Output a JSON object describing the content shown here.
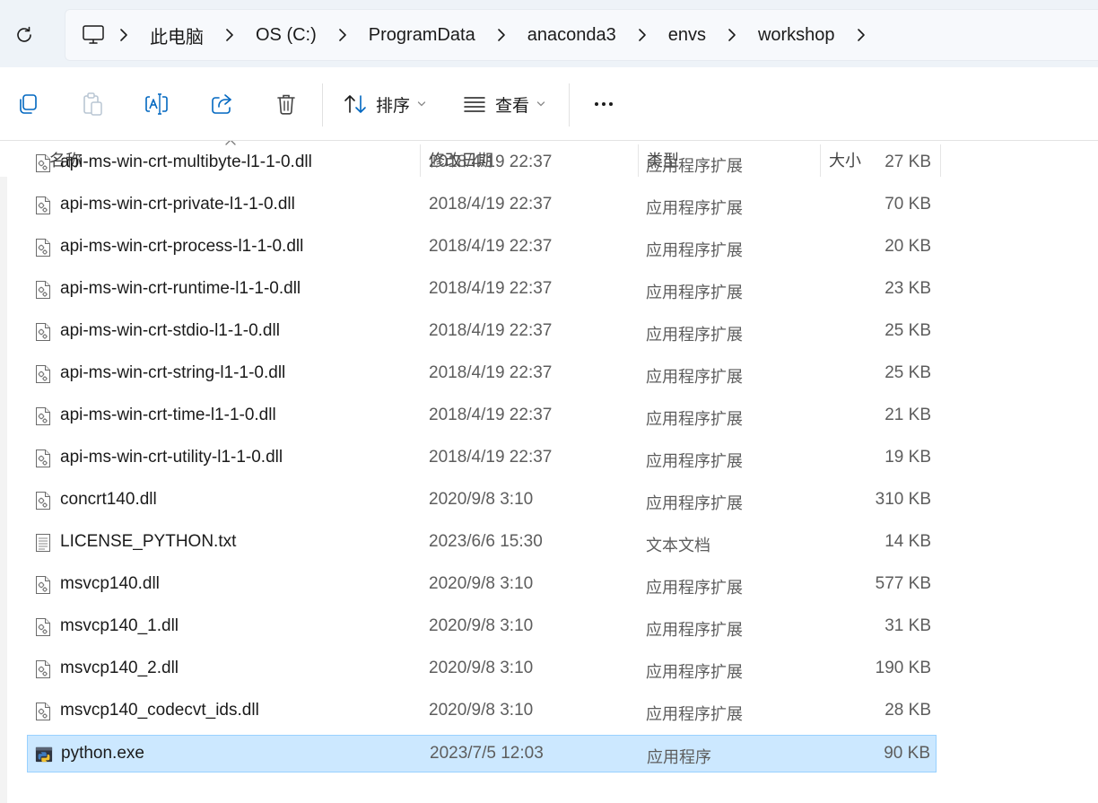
{
  "address_bar": {
    "breadcrumbs": [
      "此电脑",
      "OS (C:)",
      "ProgramData",
      "anaconda3",
      "envs",
      "workshop"
    ]
  },
  "toolbar": {
    "sort_label": "排序",
    "view_label": "查看"
  },
  "columns": {
    "name": "名称",
    "modified": "修改日期",
    "type": "类型",
    "size": "大小"
  },
  "files": [
    {
      "name": "api-ms-win-crt-multibyte-l1-1-0.dll",
      "modified": "2018/4/19 22:37",
      "type": "应用程序扩展",
      "size": "27 KB",
      "icon": "dll-file-icon"
    },
    {
      "name": "api-ms-win-crt-private-l1-1-0.dll",
      "modified": "2018/4/19 22:37",
      "type": "应用程序扩展",
      "size": "70 KB",
      "icon": "dll-file-icon"
    },
    {
      "name": "api-ms-win-crt-process-l1-1-0.dll",
      "modified": "2018/4/19 22:37",
      "type": "应用程序扩展",
      "size": "20 KB",
      "icon": "dll-file-icon"
    },
    {
      "name": "api-ms-win-crt-runtime-l1-1-0.dll",
      "modified": "2018/4/19 22:37",
      "type": "应用程序扩展",
      "size": "23 KB",
      "icon": "dll-file-icon"
    },
    {
      "name": "api-ms-win-crt-stdio-l1-1-0.dll",
      "modified": "2018/4/19 22:37",
      "type": "应用程序扩展",
      "size": "25 KB",
      "icon": "dll-file-icon"
    },
    {
      "name": "api-ms-win-crt-string-l1-1-0.dll",
      "modified": "2018/4/19 22:37",
      "type": "应用程序扩展",
      "size": "25 KB",
      "icon": "dll-file-icon"
    },
    {
      "name": "api-ms-win-crt-time-l1-1-0.dll",
      "modified": "2018/4/19 22:37",
      "type": "应用程序扩展",
      "size": "21 KB",
      "icon": "dll-file-icon"
    },
    {
      "name": "api-ms-win-crt-utility-l1-1-0.dll",
      "modified": "2018/4/19 22:37",
      "type": "应用程序扩展",
      "size": "19 KB",
      "icon": "dll-file-icon"
    },
    {
      "name": "concrt140.dll",
      "modified": "2020/9/8 3:10",
      "type": "应用程序扩展",
      "size": "310 KB",
      "icon": "dll-file-icon"
    },
    {
      "name": "LICENSE_PYTHON.txt",
      "modified": "2023/6/6 15:30",
      "type": "文本文档",
      "size": "14 KB",
      "icon": "text-file-icon"
    },
    {
      "name": "msvcp140.dll",
      "modified": "2020/9/8 3:10",
      "type": "应用程序扩展",
      "size": "577 KB",
      "icon": "dll-file-icon"
    },
    {
      "name": "msvcp140_1.dll",
      "modified": "2020/9/8 3:10",
      "type": "应用程序扩展",
      "size": "31 KB",
      "icon": "dll-file-icon"
    },
    {
      "name": "msvcp140_2.dll",
      "modified": "2020/9/8 3:10",
      "type": "应用程序扩展",
      "size": "190 KB",
      "icon": "dll-file-icon"
    },
    {
      "name": "msvcp140_codecvt_ids.dll",
      "modified": "2020/9/8 3:10",
      "type": "应用程序扩展",
      "size": "28 KB",
      "icon": "dll-file-icon"
    },
    {
      "name": "python.exe",
      "modified": "2023/7/5 12:03",
      "type": "应用程序",
      "size": "90 KB",
      "icon": "python-exe-icon",
      "selected": true
    }
  ],
  "colors": {
    "selection_bg": "#cce8ff",
    "selection_border": "#99d1ff",
    "address_bg": "#eef3f8"
  }
}
